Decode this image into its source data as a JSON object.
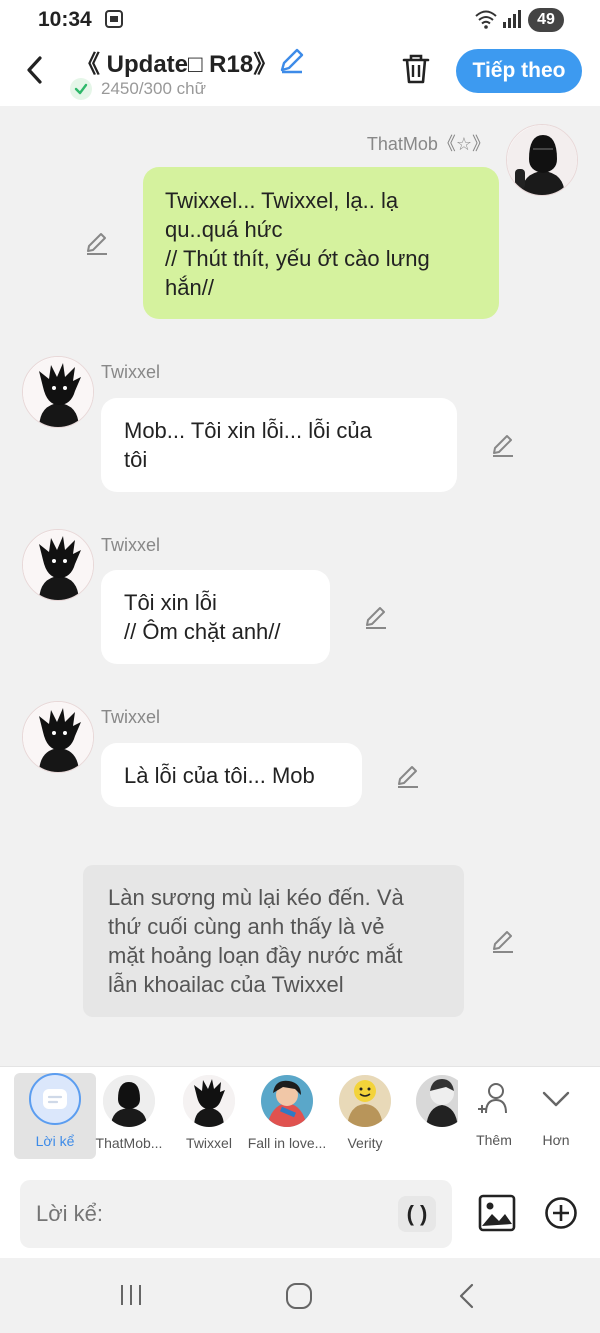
{
  "status": {
    "time": "10:34",
    "battery": "49"
  },
  "header": {
    "title": "《 Update□ R18》",
    "word_count": "2450/300 chữ",
    "next_label": "Tiếp theo"
  },
  "messages": [
    {
      "speaker": "ThatMob《☆》",
      "text_lines": [
        "Twixxel... Twixxel, lạ.. lạ",
        "qu..quá hức",
        "// Thút thít, yếu ớt cào lưng",
        "hắn//"
      ]
    },
    {
      "speaker": "Twixxel",
      "text_lines": [
        "Mob... Tôi xin lỗi... lỗi của",
        "tôi"
      ]
    },
    {
      "speaker": "Twixxel",
      "text_lines": [
        "Tôi xin lỗi",
        "// Ôm chặt anh//"
      ]
    },
    {
      "speaker": "Twixxel",
      "text_lines": [
        "Là lỗi của tôi... Mob"
      ]
    },
    {
      "speaker": "",
      "text_lines": [
        "Làn sương mù lại kéo đến. Và",
        "thứ cuối cùng anh thấy là vẻ",
        "mặt hoảng loạn đầy nước mắt",
        "lẫn khoailac của Twixxel"
      ]
    }
  ],
  "characters": [
    {
      "label": "Lời kể",
      "icon": "narration-icon"
    },
    {
      "label": "ThatMob...",
      "icon": "avatar"
    },
    {
      "label": "Twixxel",
      "icon": "avatar"
    },
    {
      "label": "Fall in love...",
      "icon": "avatar"
    },
    {
      "label": "Verity",
      "icon": "avatar"
    },
    {
      "label": "",
      "icon": "avatar"
    }
  ],
  "more": {
    "add_label": "Thêm",
    "more_label": "Hơn"
  },
  "input": {
    "placeholder": "Lời kể:",
    "paren": "( )"
  },
  "colors": {
    "accent": "#3d9af0",
    "user_bubble": "#d5f29e",
    "narration_bubble": "#e6e6e6"
  }
}
